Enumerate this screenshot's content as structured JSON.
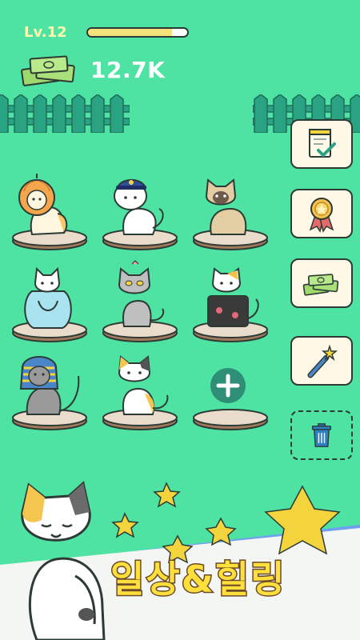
{
  "hud": {
    "level_label": "Lv.12",
    "xp_progress": 0.85,
    "money_icon": "money-stack-icon",
    "money_value": "12.7K"
  },
  "board": {
    "rows": [
      [
        "pumpkin-cat",
        "police-cat",
        "siamese-cat"
      ],
      [
        "fishbowl-cat",
        "gray-cat",
        "calico-black-cat"
      ],
      [
        "pharaoh-cat",
        "calico-cat",
        "empty-slot"
      ]
    ],
    "add_icon": "plus-icon"
  },
  "side_menu": [
    {
      "icon": "checklist-icon"
    },
    {
      "icon": "award-ribbon-icon"
    },
    {
      "icon": "money-stack-icon"
    },
    {
      "icon": "magic-wand-icon"
    },
    {
      "icon": "trash-icon"
    }
  ],
  "banner": {
    "slogan": "일상&힐링",
    "icons": [
      "star-icon",
      "calico-cat-mascot"
    ]
  },
  "colors": {
    "background": "#4ee3a2",
    "fence": "#2aa383",
    "level_text": "#fff8b0",
    "xp_fill": "#f6e27a",
    "slogan": "#ffdf3b",
    "banner_white": "#f3f6f3",
    "banner_blue": "#6ea0f0"
  }
}
